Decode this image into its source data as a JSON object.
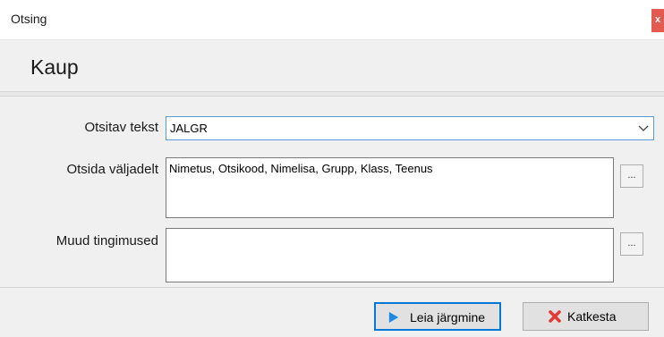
{
  "window": {
    "title": "Otsing",
    "close_label": "x"
  },
  "header": {
    "title": "Kaup"
  },
  "form": {
    "search_text": {
      "label": "Otsitav tekst",
      "value": "JALGR"
    },
    "search_fields": {
      "label": "Otsida väljadelt",
      "value": "Nimetus, Otsikood, Nimelisa, Grupp, Klass, Teenus",
      "browse_label": "..."
    },
    "other_conditions": {
      "label": "Muud tingimused",
      "value": "",
      "browse_label": "..."
    }
  },
  "footer": {
    "find_next_label": "Leia järgmine",
    "cancel_label": "Katkesta"
  },
  "colors": {
    "close_button": "#e35b50",
    "focus_border": "#0078d7",
    "play_icon": "#1e88e5",
    "cancel_icon": "#e53935"
  },
  "icons": {
    "combo_arrow": "chevron-down-icon",
    "find_next": "play-icon",
    "cancel": "x-icon"
  }
}
